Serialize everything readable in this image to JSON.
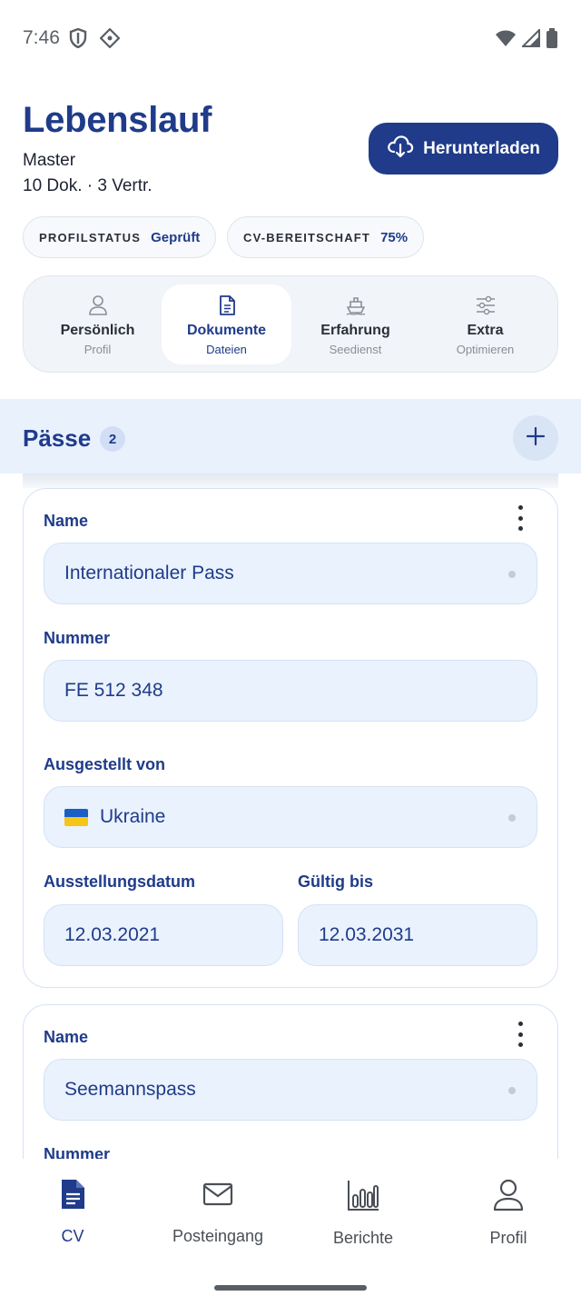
{
  "status_bar": {
    "time": "7:46",
    "left_icons": [
      "shield-icon",
      "location-diamond-icon"
    ],
    "right_icons": [
      "wifi-icon",
      "signal-icon",
      "battery-icon"
    ]
  },
  "header": {
    "title": "Lebenslauf",
    "rank": "Master",
    "summary": "10 Dok. · 3 Vertr.",
    "download_label": "Herunterladen"
  },
  "chips": [
    {
      "label": "PROFILSTATUS",
      "value": "Geprüft"
    },
    {
      "label": "CV-BEREITSCHAFT",
      "value": "75%"
    }
  ],
  "tabs": [
    {
      "label": "Persönlich",
      "sub": "Profil",
      "icon": "person-icon",
      "active": false
    },
    {
      "label": "Dokumente",
      "sub": "Dateien",
      "icon": "document-icon",
      "active": true
    },
    {
      "label": "Erfahrung",
      "sub": "Seedienst",
      "icon": "ship-icon",
      "active": false
    },
    {
      "label": "Extra",
      "sub": "Optimieren",
      "icon": "sliders-icon",
      "active": false
    }
  ],
  "section": {
    "title": "Pässe",
    "count": "2"
  },
  "cards": [
    {
      "name_label": "Name",
      "name_value": "Internationaler Pass",
      "number_label": "Nummer",
      "number_value": "FE 512 348",
      "issued_by_label": "Ausgestellt von",
      "issued_by_value": "Ukraine",
      "issue_date_label": "Ausstellungsdatum",
      "issue_date_value": "12.03.2021",
      "valid_until_label": "Gültig bis",
      "valid_until_value": "12.03.2031"
    },
    {
      "name_label": "Name",
      "name_value": "Seemannspass",
      "number_label": "Nummer"
    }
  ],
  "bottom_nav": [
    {
      "label": "CV",
      "icon": "cv-document-icon",
      "active": true
    },
    {
      "label": "Posteingang",
      "icon": "mail-icon",
      "active": false
    },
    {
      "label": "Berichte",
      "icon": "bar-chart-icon",
      "active": false
    },
    {
      "label": "Profil",
      "icon": "profile-icon",
      "active": false
    }
  ],
  "colors": {
    "primary": "#1f3b8a",
    "field_bg": "#eaf2fd",
    "section_bg": "#e9f1fd"
  }
}
